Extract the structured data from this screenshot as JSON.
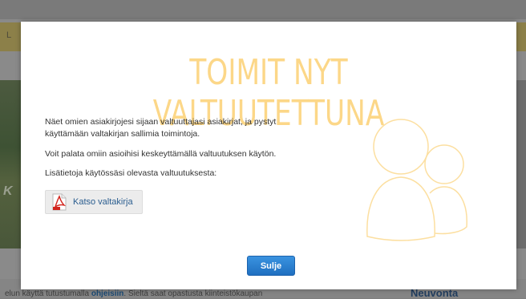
{
  "background": {
    "banner_fragment": "L",
    "image_fragment": "K",
    "footer_text": "elun käyttä tutustumalla",
    "footer_link": "ohjeisiin",
    "footer_text_after": ". Sieltä saat opastusta kiinteistökaupan",
    "side_heading": "Neuvonta"
  },
  "modal": {
    "title": "TOIMIT NYT VALTUUTETTUNA",
    "paragraph1": "Näet omien asiakirjojesi sijaan valtuuttajasi asiakirjat, ja pystyt käyttämään valtakirjan sallimia toimintoja.",
    "paragraph2": "Voit palata omiin asioihisi keskeyttämällä valtuutuksen käytön.",
    "paragraph3": "Lisätietoja käytössäsi olevasta valtuutuksesta:",
    "document_button_label": "Katso valtakirja",
    "document_icon": "pdf-icon",
    "illustration_icon": "users-icon",
    "close_button_label": "Sulje"
  },
  "colors": {
    "title": "#fcd788",
    "close_button": "#2a7fd4",
    "link": "#2a5d8f"
  }
}
